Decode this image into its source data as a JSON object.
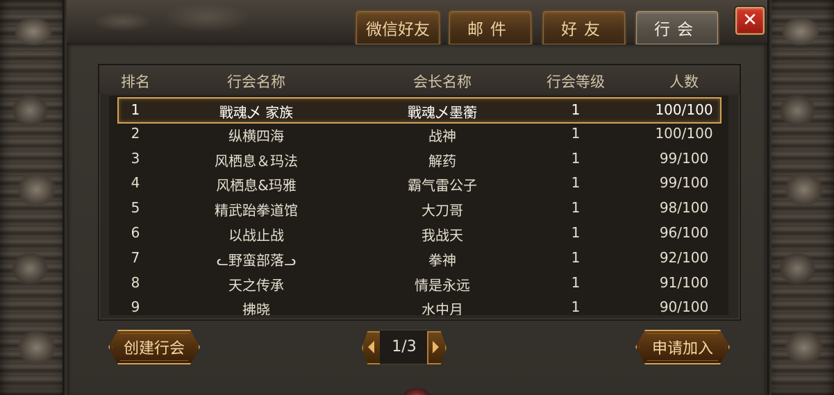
{
  "tabs": [
    {
      "label": "微信好友",
      "active": false
    },
    {
      "label": "邮件",
      "active": false
    },
    {
      "label": "好友",
      "active": false
    },
    {
      "label": "行会",
      "active": true
    }
  ],
  "close": {
    "label": "✕",
    "icon": "close-icon",
    "color": "#c62a1c"
  },
  "table": {
    "headers": {
      "rank": "排名",
      "guild_name": "行会名称",
      "leader": "会长名称",
      "level": "行会等级",
      "members": "人数"
    },
    "rows": [
      {
        "rank": "1",
        "guild_name": "戰魂乄 家族",
        "leader": "戰魂乄墨蘅",
        "level": "1",
        "members": "100/100",
        "selected": true
      },
      {
        "rank": "2",
        "guild_name": "纵横四海",
        "leader": "战神",
        "level": "1",
        "members": "100/100"
      },
      {
        "rank": "3",
        "guild_name": "风栖息＆玛法",
        "leader": "解药",
        "level": "1",
        "members": "99/100"
      },
      {
        "rank": "4",
        "guild_name": "风栖息&玛雅",
        "leader": "霸气雷公子",
        "level": "1",
        "members": "99/100"
      },
      {
        "rank": "5",
        "guild_name": "精武跆拳道馆",
        "leader": "大刀哥",
        "level": "1",
        "members": "98/100"
      },
      {
        "rank": "6",
        "guild_name": "以战止战",
        "leader": "我战天",
        "level": "1",
        "members": "96/100"
      },
      {
        "rank": "7",
        "guild_name": "ᓚ野蛮部落ᓗ",
        "leader": "拳神",
        "level": "1",
        "members": "92/100"
      },
      {
        "rank": "8",
        "guild_name": "天之传承",
        "leader": "情是永远",
        "level": "1",
        "members": "91/100"
      },
      {
        "rank": "9",
        "guild_name": "拂晓",
        "leader": "水中月",
        "level": "1",
        "members": "90/100"
      }
    ]
  },
  "buttons": {
    "create": "创建行会",
    "apply": "申请加入"
  },
  "pager": {
    "indicator": "1/3",
    "prev_icon": "arrow-left-icon",
    "next_icon": "arrow-right-icon"
  },
  "colors": {
    "accent_gold": "#d6a252",
    "tab_text": "#f0d2a0",
    "table_text": "#e6dfcf"
  }
}
